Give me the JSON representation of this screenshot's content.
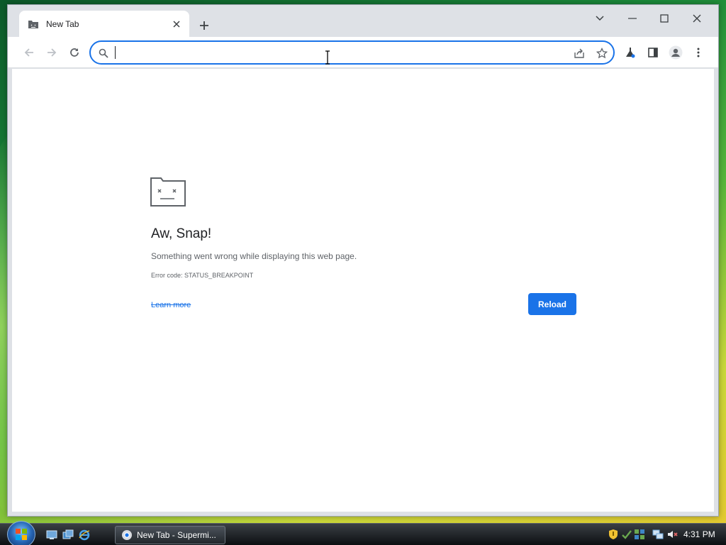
{
  "browser": {
    "tab": {
      "title": "New Tab"
    },
    "omnibox": {
      "value": "",
      "placeholder": ""
    }
  },
  "error_page": {
    "title": "Aw, Snap!",
    "message": "Something went wrong while displaying this web page.",
    "error_code": "Error code: STATUS_BREAKPOINT",
    "learn_more_label": "Learn more",
    "reload_label": "Reload"
  },
  "taskbar": {
    "active_task_label": "New Tab - Supermi...",
    "clock": "4:31 PM"
  },
  "colors": {
    "accent": "#1a73e8",
    "tabstrip_bg": "#dee1e6",
    "text_primary": "#202124",
    "text_secondary": "#5f6368"
  },
  "icons": {
    "tab_favicon": "sad-tab-icon",
    "close": "close-icon",
    "new_tab": "plus-icon",
    "back": "back-arrow-icon",
    "forward": "forward-arrow-icon",
    "reload": "reload-icon",
    "search": "search-icon",
    "share": "share-icon",
    "bookmark": "star-icon",
    "labs": "flask-icon",
    "side_panel": "side-panel-icon",
    "profile": "profile-icon",
    "menu": "kebab-menu-icon"
  }
}
